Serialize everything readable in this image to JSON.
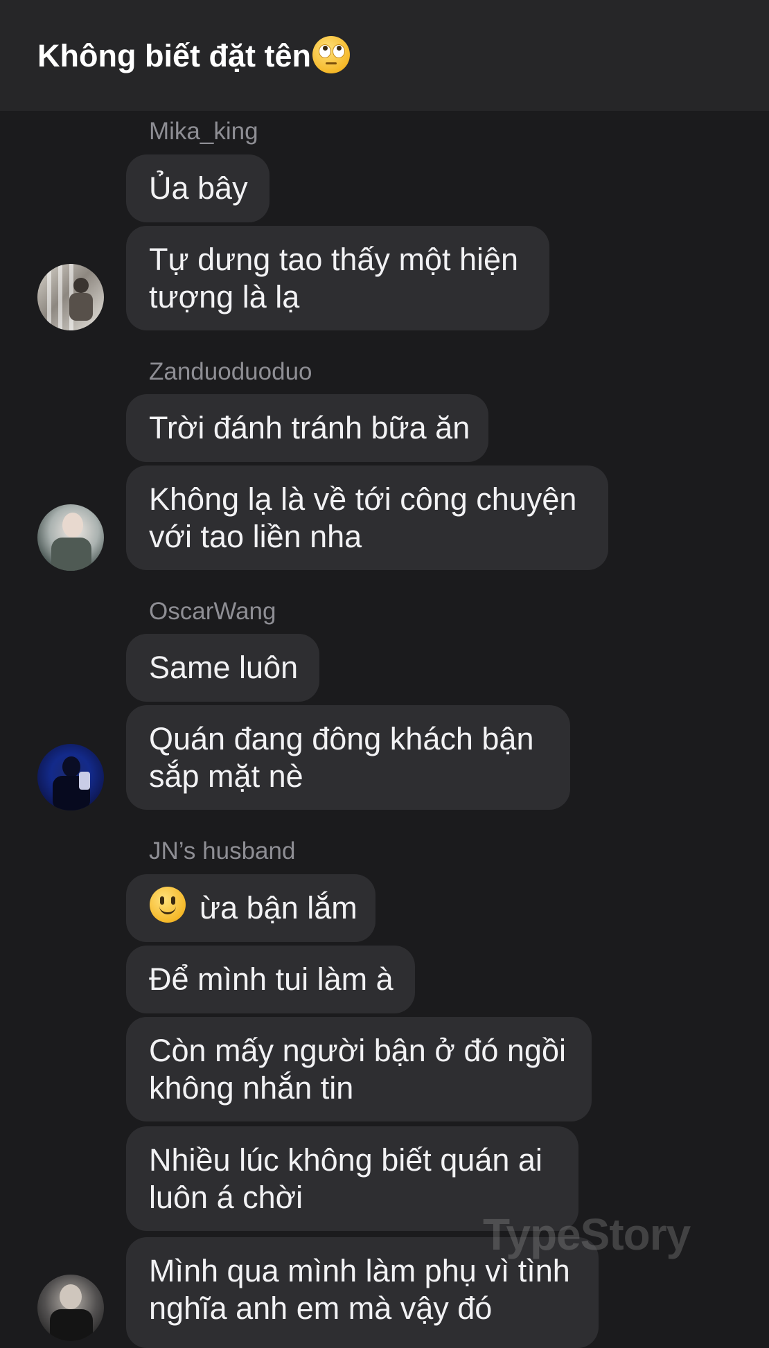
{
  "header": {
    "title": "Không biết đặt tên",
    "title_emoji": "rolling-eyes-emoji"
  },
  "groups": [
    {
      "sender": "Mika_king",
      "avatar": "avatar-mika-king",
      "messages": [
        "Ủa bây",
        "Tự dưng tao thấy một hiện\ntượng là lạ"
      ]
    },
    {
      "sender": "Zanduoduoduo",
      "avatar": "avatar-zanduoduoduo",
      "messages": [
        "Trời đánh tránh bữa ăn",
        "Không lạ là về tới công chuyện\nvới tao liền nha"
      ]
    },
    {
      "sender": "OscarWang",
      "avatar": "avatar-oscarwang",
      "messages": [
        "Same luôn",
        "Quán đang đông khách bận\nsắp mặt nè"
      ]
    },
    {
      "sender": "JN’s husband",
      "avatar": "avatar-jn-husband",
      "messages": [
        "ừa bận lắm",
        "Để mình tui làm à",
        "Còn mấy người bận ở đó ngồi\nkhông nhắn tin",
        "Nhiều lúc không biết quán ai\nluôn á chời",
        "Mình qua mình làm phụ vì tình\nnghĩa anh em mà vậy đó"
      ],
      "first_message_emoji": "slightly-smiling-face-emoji"
    }
  ],
  "watermark": "TypeStory",
  "colors": {
    "background": "#1b1b1d",
    "header_bg": "#262628",
    "bubble_bg": "#2e2e31",
    "sender_text": "#8e8e94",
    "message_text": "#f2f2f4"
  }
}
